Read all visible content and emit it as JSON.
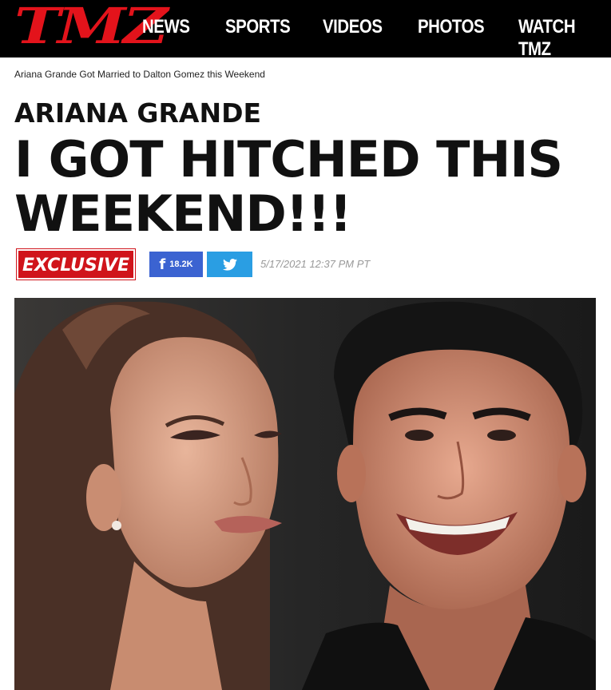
{
  "brand": {
    "logo": "TMZ",
    "color": "#e3131b"
  },
  "nav": {
    "items": [
      "NEWS",
      "SPORTS",
      "VIDEOS",
      "PHOTOS",
      "WATCH TMZ"
    ]
  },
  "breadcrumb": "Ariana Grande Got Married to Dalton Gomez this Weekend",
  "article": {
    "kicker": "ARIANA GRANDE",
    "headline_line1": "I GOT HITCHED THIS",
    "headline_line2": "WEEKEND!!!",
    "badge": "EXCLUSIVE",
    "share": {
      "facebook_count": "18.2K",
      "facebook_icon": "facebook-icon",
      "twitter_icon": "twitter-icon"
    },
    "timestamp": "5/17/2021 12:37 PM PT"
  },
  "colors": {
    "badge": "#d0141b",
    "facebook": "#3b63d1",
    "twitter": "#2a9ee3"
  }
}
